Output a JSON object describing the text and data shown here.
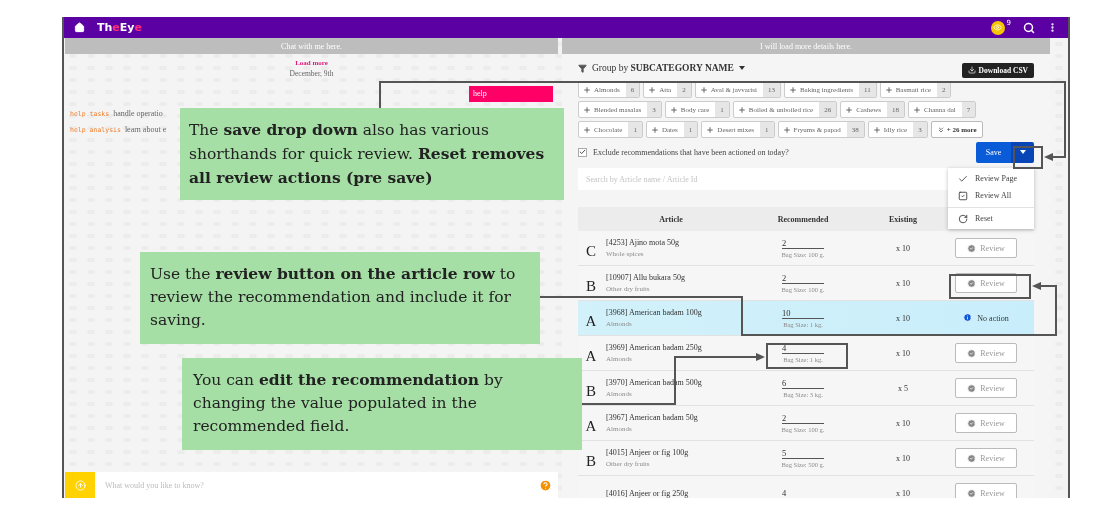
{
  "topbar": {
    "logo": [
      {
        "text": "Th",
        "accent": false
      },
      {
        "text": "e",
        "accent": true
      },
      {
        "text": "Ey",
        "accent": false
      },
      {
        "text": "e",
        "accent": true
      }
    ],
    "coin_count": "9"
  },
  "chat": {
    "header": "Chat with me here.",
    "load_more": "Load more",
    "date": "December, 9th",
    "user_message": "help",
    "help_lines": [
      {
        "command": "help tasks",
        "text": "handle operatio"
      },
      {
        "command": "help analysis",
        "text": "learn about e"
      }
    ],
    "input": {
      "placeholder": "What would you like to know?"
    }
  },
  "details": {
    "header": "I will load more details here.",
    "group_by": {
      "label": "Group by",
      "value": "SUBCATEGORY NAME"
    },
    "download_button": "Download CSV",
    "chip_rows": [
      [
        {
          "label": "Almonds",
          "count": "6"
        },
        {
          "label": "Atta",
          "count": "2"
        },
        {
          "label": "Aval & javvarisi",
          "count": "13"
        },
        {
          "label": "Baking ingredients",
          "count": "11"
        },
        {
          "label": "Basmati rice",
          "count": "2"
        }
      ],
      [
        {
          "label": "Blended masalas",
          "count": "3"
        },
        {
          "label": "Body care",
          "count": "1"
        },
        {
          "label": "Boiled & unboiled rice",
          "count": "26"
        },
        {
          "label": "Cashews",
          "count": "18"
        },
        {
          "label": "Channa dal",
          "count": "7"
        }
      ],
      [
        {
          "label": "Chocolate",
          "count": "1"
        },
        {
          "label": "Dates",
          "count": "1"
        },
        {
          "label": "Desert mixes",
          "count": "1"
        },
        {
          "label": "Fryums & papad",
          "count": "38"
        },
        {
          "label": "Idly rice",
          "count": "3"
        }
      ]
    ],
    "more_chip": "+ 26 more",
    "exclude": {
      "label": "Exclude recommendations that have been actioned on today?",
      "checked": true
    },
    "save_button": "Save",
    "save_menu": [
      {
        "kind": "check",
        "label": "Review Page"
      },
      {
        "kind": "checkbox",
        "label": "Review All"
      },
      {
        "kind": "reset",
        "label": "Reset"
      }
    ],
    "search": {
      "placeholder": "Search by Article name / Article Id"
    },
    "table": {
      "columns": [
        "Article",
        "Recommended",
        "Existing"
      ],
      "rows": [
        {
          "grade": "C",
          "article": "[4253] Ajino mota 50g",
          "subcategory": "Whole spices",
          "recommended": "2",
          "bag_size": "Bag Size: 100 g.",
          "existing": "x 10",
          "action": {
            "kind": "review",
            "label": "Review"
          },
          "highlighted": false
        },
        {
          "grade": "B",
          "article": "[10907] Allu bukara 50g",
          "subcategory": "Other dry fruits",
          "recommended": "2",
          "bag_size": "Bag Size: 100 g.",
          "existing": "x 10",
          "action": {
            "kind": "review",
            "label": "Review"
          },
          "highlighted": false
        },
        {
          "grade": "A",
          "article": "[3968] American badam 100g",
          "subcategory": "Almonds",
          "recommended": "10",
          "bag_size": "Bag Size: 1 kg.",
          "existing": "x 10",
          "action": {
            "kind": "none",
            "label": "No action"
          },
          "highlighted": true
        },
        {
          "grade": "A",
          "article": "[3969] American badam 250g",
          "subcategory": "Almonds",
          "recommended": "4",
          "bag_size": "Bag Size: 1 kg.",
          "existing": "x 10",
          "action": {
            "kind": "review",
            "label": "Review"
          },
          "highlighted": false
        },
        {
          "grade": "B",
          "article": "[3970] American badam 500g",
          "subcategory": "Almonds",
          "recommended": "6",
          "bag_size": "Bag Size: 3 kg.",
          "existing": "x 5",
          "action": {
            "kind": "review",
            "label": "Review"
          },
          "highlighted": false
        },
        {
          "grade": "A",
          "article": "[3967] American badam 50g",
          "subcategory": "Almonds",
          "recommended": "2",
          "bag_size": "Bag Size: 100 g.",
          "existing": "x 10",
          "action": {
            "kind": "review",
            "label": "Review"
          },
          "highlighted": false
        },
        {
          "grade": "B",
          "article": "[4015] Anjeer or fig 100g",
          "subcategory": "Other dry fruits",
          "recommended": "5",
          "bag_size": "Bag Size: 500 g.",
          "existing": "x 10",
          "action": {
            "kind": "review",
            "label": "Review"
          },
          "highlighted": false
        },
        {
          "article": "[4016] Anjeer or fig 250g",
          "recommended": "4",
          "existing": "x 10",
          "action": {
            "kind": "review",
            "label": "Review"
          },
          "highlighted": false
        }
      ]
    }
  },
  "callouts": [
    {
      "text": "The **save drop down** also has various shorthands for quick review. **Reset removes all review actions (pre save)**"
    },
    {
      "text": "Use the **review button on the article row** to review the recommendation and include it for saving."
    },
    {
      "text": "You can **edit the recommendation** by changing the value populated in the recommended field."
    }
  ]
}
